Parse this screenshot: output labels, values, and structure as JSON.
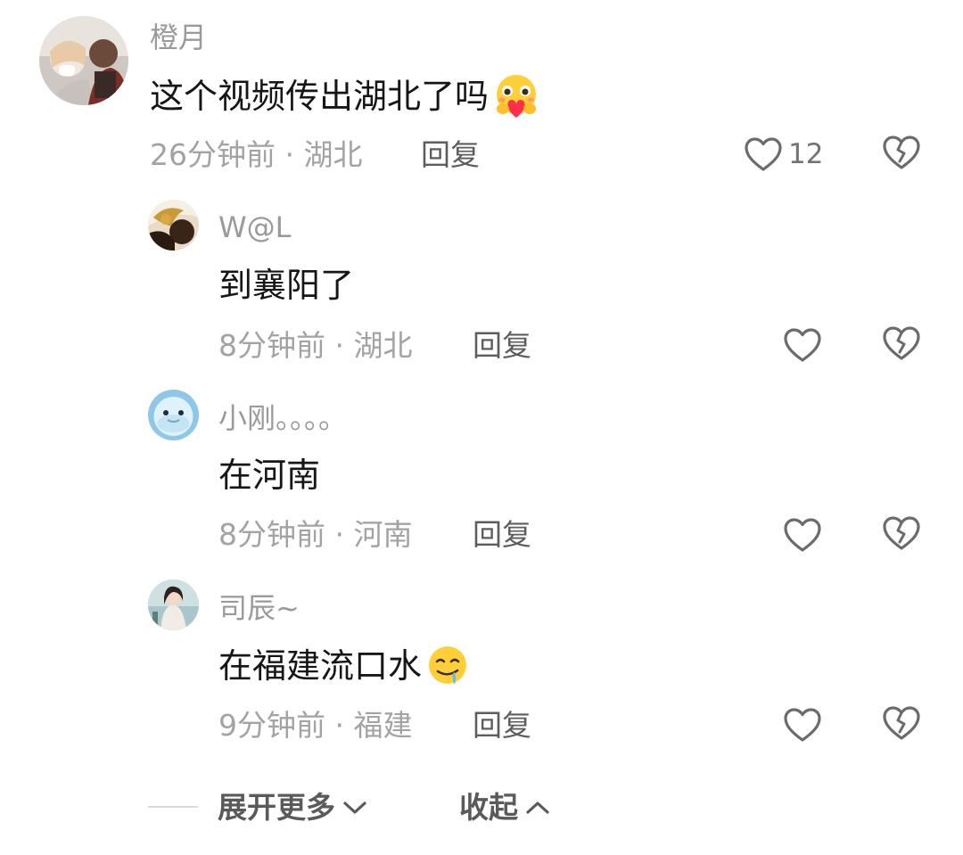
{
  "comment": {
    "username": "橙月",
    "text": "这个视频传出湖北了吗",
    "emoji": "hugging-face-heart-emoji",
    "meta": "26分钟前 · 湖北",
    "reply_label": "回复",
    "likes": "12"
  },
  "replies": [
    {
      "username": "W@L",
      "text": "到襄阳了",
      "meta": "8分钟前 · 湖北",
      "reply_label": "回复"
    },
    {
      "username": "小刚。。。。",
      "text": "在河南",
      "meta": "8分钟前 · 河南",
      "reply_label": "回复"
    },
    {
      "username": "司辰~",
      "text": "在福建流口水",
      "emoji": "drooling-face-emoji",
      "meta": "9分钟前 · 福建",
      "reply_label": "回复"
    }
  ],
  "footer": {
    "expand_label": "展开更多",
    "collapse_label": "收起"
  },
  "colors": {
    "username": "#9a9a9a",
    "meta": "#a3a3a3",
    "icon": "#6b6b6b"
  }
}
